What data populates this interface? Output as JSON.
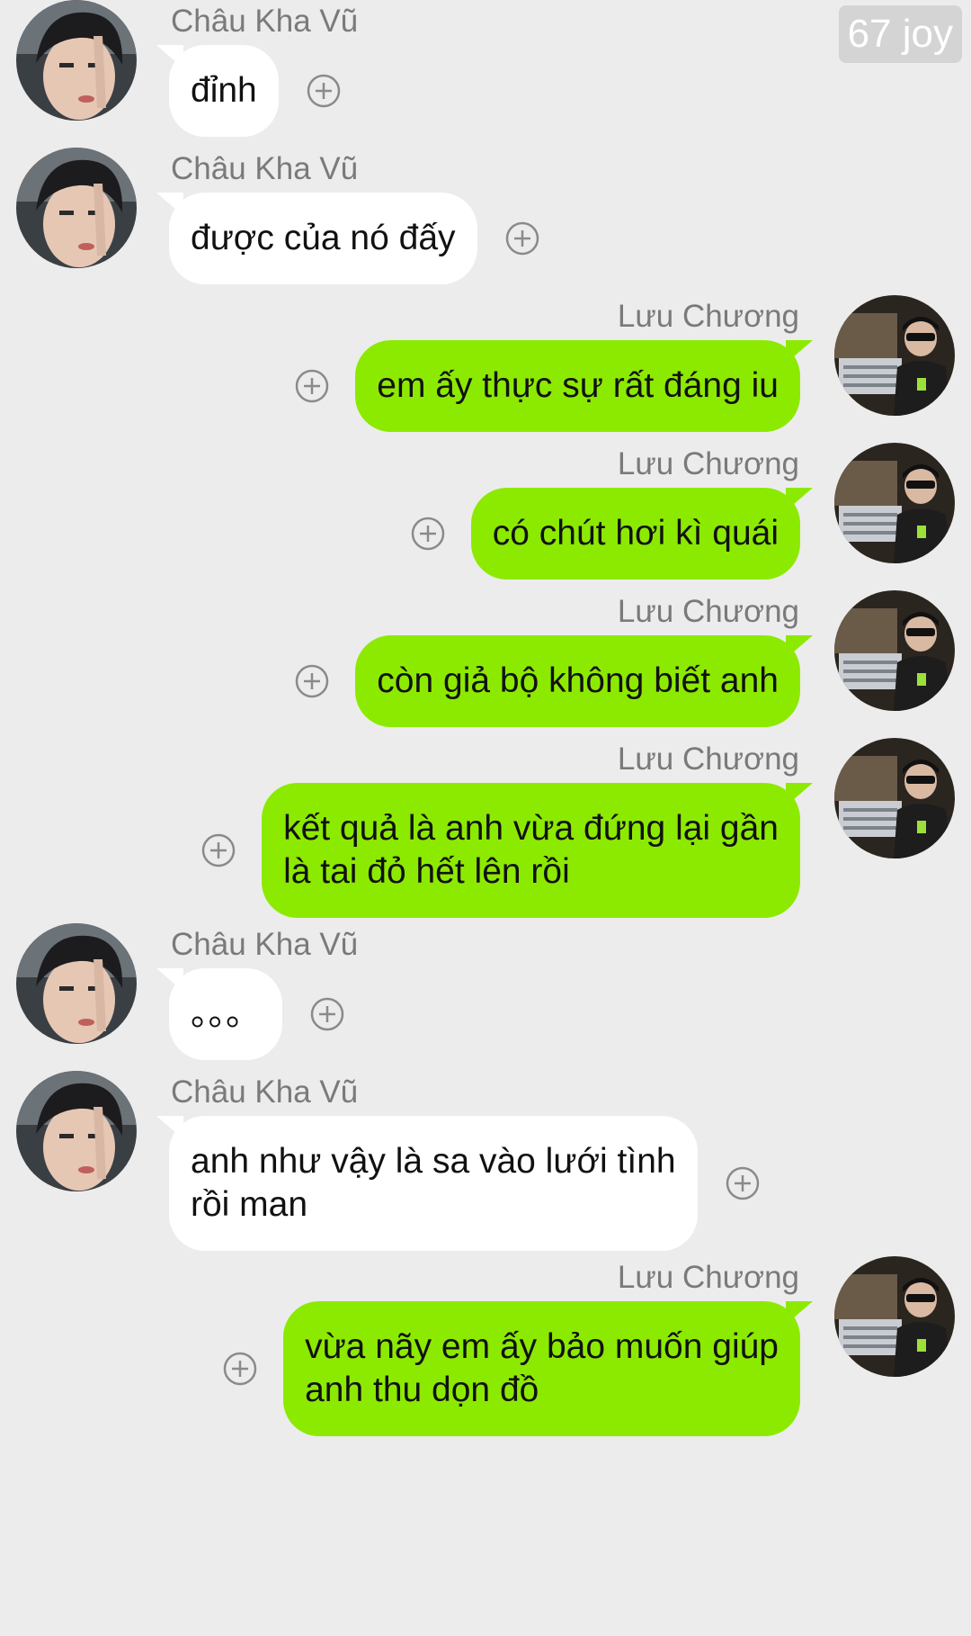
{
  "watermark": "67 joy",
  "messages": [
    {
      "side": "left",
      "sender": "Châu Kha Vũ",
      "lines": [
        "đỉnh"
      ]
    },
    {
      "side": "left",
      "sender": "Châu Kha Vũ",
      "lines": [
        "được của nó đấy"
      ]
    },
    {
      "side": "right",
      "sender": "Lưu Chương",
      "lines": [
        "em ấy thực sự rất đáng iu"
      ]
    },
    {
      "side": "right",
      "sender": "Lưu Chương",
      "lines": [
        "có chút hơi kì quái"
      ]
    },
    {
      "side": "right",
      "sender": "Lưu Chương",
      "lines": [
        "còn giả bộ không biết anh"
      ]
    },
    {
      "side": "right",
      "sender": "Lưu Chương",
      "lines": [
        "kết quả là anh vừa đứng lại gần",
        "là tai đỏ hết lên rồi"
      ]
    },
    {
      "side": "left",
      "sender": "Châu Kha Vũ",
      "lines": [
        "。。。"
      ]
    },
    {
      "side": "left",
      "sender": "Châu Kha Vũ",
      "lines": [
        "anh như vậy là sa vào lưới tình",
        "rồi man"
      ]
    },
    {
      "side": "right",
      "sender": "Lưu Chương",
      "lines": [
        "vừa nãy em ấy bảo muốn giúp",
        "anh thu dọn đồ"
      ]
    }
  ],
  "icons": {
    "add_reaction": "plus-circle-icon",
    "avatar_left": "avatar-photo",
    "avatar_right": "avatar-photo"
  },
  "colors": {
    "background": "#ececec",
    "left_bubble": "#ffffff",
    "right_bubble": "#8cea00",
    "name_text": "#7a7a7a"
  }
}
